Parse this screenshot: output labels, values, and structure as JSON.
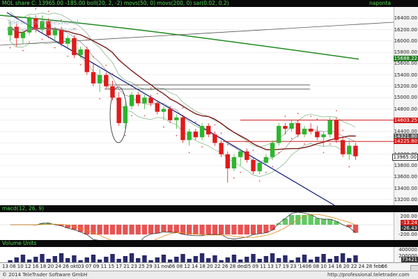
{
  "header": {
    "title": "MOL share C: 13965.00 -185.00 boll(20, 2, -2) movs(50, 0) movs(200, 0) sar(0.02, 0.2)",
    "interval": "napontа"
  },
  "watermark": {
    "brand": "TeleTrader Professional",
    "sub": "http://professional.teletrader.com"
  },
  "price_axis": {
    "ticks": [
      "16400.00",
      "16200.00",
      "16000.00",
      "15800.00",
      "15600.00",
      "15400.00",
      "15200.00",
      "15000.00",
      "14800.00",
      "14600.00",
      "14400.00",
      "14200.00",
      "14000.00",
      "13800.00",
      "13600.00",
      "13400.00",
      "13200.00"
    ],
    "tags": [
      {
        "label": "15688.22",
        "color": "#1f7a1f"
      },
      {
        "label": "14603.25",
        "color": "#d01a1a"
      },
      {
        "label": "14321.80",
        "color": "#555555"
      },
      {
        "label": "14225.80",
        "color": "#d01a1a"
      },
      {
        "label": "13965.00",
        "color": "#ffffff",
        "text": "#000000"
      }
    ]
  },
  "macd": {
    "title": "macd(12, 26, 9)",
    "ticks": [
      "200.00",
      "0.00",
      "-200.00"
    ],
    "tags": [
      {
        "label": "-13.24",
        "color": "#d01a1a"
      },
      {
        "label": "-26.43",
        "color": "#333333"
      }
    ]
  },
  "volume": {
    "title": "Volume Units",
    "ticks": [
      "400000",
      "200000"
    ],
    "tags": [
      {
        "label": "73421",
        "color": "#333333"
      }
    ]
  },
  "dates": [
    "13",
    "06",
    "10",
    "12",
    "16",
    "18",
    "20",
    "24",
    "26",
    "okt.",
    "03",
    "07",
    "09",
    "11",
    "15",
    "17",
    "21",
    "23",
    "25",
    "29",
    "31",
    "nov.",
    "06",
    "08",
    "12",
    "14",
    "18",
    "20",
    "22",
    "26",
    "28",
    "dec.",
    "05",
    "09",
    "11",
    "13",
    "17",
    "19",
    "23",
    "'14",
    "06",
    "08",
    "10",
    "14",
    "16",
    "20",
    "22",
    "24",
    "28",
    "febr.",
    "06"
  ],
  "footer": {
    "copyright": "© 2014 TeleTrader Software GmbH",
    "url": "http://professional.teletrader.com"
  },
  "chart_data": {
    "type": "candlestick",
    "title": "MOL share",
    "last": 13965.0,
    "change": -185.0,
    "ylim": [
      13100,
      16600
    ],
    "indicators": [
      "boll(20, 2, -2)",
      "movs(50, 0)",
      "movs(200, 0)",
      "sar(0.02, 0.2)"
    ],
    "ohlc": [
      [
        16100,
        16350,
        16000,
        16250
      ],
      [
        16250,
        16300,
        15900,
        16050
      ],
      [
        16050,
        16200,
        15950,
        16150
      ],
      [
        16150,
        16450,
        16100,
        16400
      ],
      [
        16400,
        16450,
        16150,
        16200
      ],
      [
        16200,
        16450,
        16150,
        16350
      ],
      [
        16350,
        16400,
        16050,
        16100
      ],
      [
        16100,
        16250,
        16000,
        16200
      ],
      [
        16200,
        16250,
        15900,
        15950
      ],
      [
        15950,
        16100,
        15850,
        16050
      ],
      [
        16050,
        16100,
        15700,
        15750
      ],
      [
        15750,
        15900,
        15700,
        15850
      ],
      [
        15850,
        15900,
        15400,
        15450
      ],
      [
        15450,
        15600,
        15200,
        15250
      ],
      [
        15250,
        15500,
        15100,
        15400
      ],
      [
        15400,
        15450,
        15150,
        15200
      ],
      [
        15200,
        15300,
        14950,
        15000
      ],
      [
        15000,
        15100,
        14500,
        14550
      ],
      [
        14550,
        14900,
        14450,
        14850
      ],
      [
        14850,
        15100,
        14800,
        15050
      ],
      [
        15050,
        15100,
        14850,
        14900
      ],
      [
        14900,
        15050,
        14800,
        15000
      ],
      [
        15000,
        15050,
        14850,
        14900
      ],
      [
        14900,
        14950,
        14700,
        14750
      ],
      [
        14750,
        14850,
        14600,
        14800
      ],
      [
        14800,
        14850,
        14550,
        14600
      ],
      [
        14600,
        14700,
        14450,
        14650
      ],
      [
        14650,
        14700,
        14200,
        14250
      ],
      [
        14250,
        14450,
        14150,
        14400
      ],
      [
        14400,
        14450,
        14250,
        14300
      ],
      [
        14300,
        14550,
        14250,
        14500
      ],
      [
        14500,
        14550,
        14300,
        14350
      ],
      [
        14350,
        14400,
        14150,
        14200
      ],
      [
        14200,
        14250,
        13950,
        14000
      ],
      [
        14000,
        14050,
        13500,
        13750
      ],
      [
        13750,
        14000,
        13700,
        13950
      ],
      [
        13950,
        14100,
        13800,
        14050
      ],
      [
        14050,
        14100,
        13850,
        13900
      ],
      [
        13900,
        13950,
        13650,
        13700
      ],
      [
        13700,
        13900,
        13650,
        13850
      ],
      [
        13850,
        14000,
        13800,
        13950
      ],
      [
        13950,
        14250,
        13900,
        14200
      ],
      [
        14200,
        14550,
        14150,
        14500
      ],
      [
        14500,
        14550,
        14350,
        14450
      ],
      [
        14450,
        14600,
        14400,
        14550
      ],
      [
        14550,
        14600,
        14300,
        14350
      ],
      [
        14350,
        14500,
        14300,
        14450
      ],
      [
        14450,
        14550,
        14350,
        14400
      ],
      [
        14400,
        14500,
        14250,
        14300
      ],
      [
        14300,
        14400,
        14150,
        14350
      ],
      [
        14350,
        14650,
        14300,
        14600
      ],
      [
        14600,
        14650,
        14200,
        14250
      ],
      [
        14250,
        14300,
        13950,
        14000
      ],
      [
        14000,
        14250,
        13900,
        14150
      ],
      [
        14150,
        14200,
        13900,
        13965
      ]
    ]
  }
}
